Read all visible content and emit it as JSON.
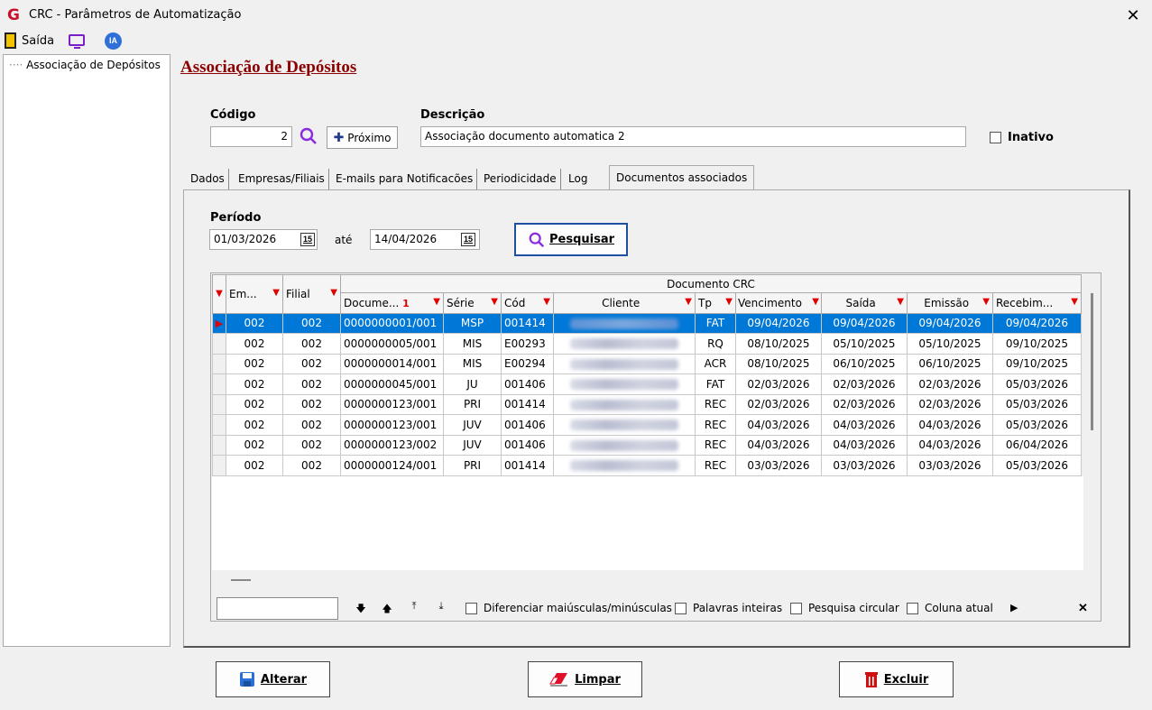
{
  "window": {
    "title": "CRC - Parâmetros de Automatização",
    "app_glyph": "G"
  },
  "menu": {
    "saida": "Saída",
    "ia": "IA"
  },
  "tree": {
    "item": "Associação de Depósitos"
  },
  "page": {
    "title": "Associação de Depósitos"
  },
  "form": {
    "codigo_label": "Código",
    "codigo_value": "2",
    "proximo_label": "Próximo",
    "descricao_label": "Descrição",
    "descricao_value": "Associação documento automatica 2",
    "inativo_label": "Inativo"
  },
  "tabs": [
    "Dados",
    "Empresas/Filiais",
    "E-mails para Notificacões",
    "Periodicidade",
    "Log",
    "Documentos associados"
  ],
  "periodo": {
    "label": "Período",
    "from": "01/03/2026",
    "ate": "até",
    "to": "14/04/2026",
    "calendar_glyph": "15",
    "search_label": "Pesquisar"
  },
  "grid": {
    "group_header": "Documento CRC",
    "headers": [
      "Em...",
      "Filial",
      "Docume...",
      "Série",
      "Cód",
      "Cliente",
      "Tp",
      "Vencimento",
      "Saída",
      "Emissão",
      "Recebim..."
    ],
    "sort_badge": "1",
    "rows": [
      [
        "002",
        "002",
        "0000000001/001",
        "MSP",
        "001414",
        "",
        "FAT",
        "09/04/2026",
        "09/04/2026",
        "09/04/2026",
        "09/04/2026"
      ],
      [
        "002",
        "002",
        "0000000005/001",
        "MIS",
        "E00293",
        "",
        "RQ",
        "08/10/2025",
        "05/10/2025",
        "05/10/2025",
        "09/10/2025"
      ],
      [
        "002",
        "002",
        "0000000014/001",
        "MIS",
        "E00294",
        "",
        "ACR",
        "08/10/2025",
        "06/10/2025",
        "06/10/2025",
        "09/10/2025"
      ],
      [
        "002",
        "002",
        "0000000045/001",
        "JU",
        "001406",
        "",
        "FAT",
        "02/03/2026",
        "02/03/2026",
        "02/03/2026",
        "05/03/2026"
      ],
      [
        "002",
        "002",
        "0000000123/001",
        "PRI",
        "001414",
        "",
        "REC",
        "02/03/2026",
        "02/03/2026",
        "02/03/2026",
        "05/03/2026"
      ],
      [
        "002",
        "002",
        "0000000123/001",
        "JUV",
        "001406",
        "",
        "REC",
        "04/03/2026",
        "04/03/2026",
        "04/03/2026",
        "05/03/2026"
      ],
      [
        "002",
        "002",
        "0000000123/002",
        "JUV",
        "001406",
        "",
        "REC",
        "04/03/2026",
        "04/03/2026",
        "04/03/2026",
        "06/04/2026"
      ],
      [
        "002",
        "002",
        "0000000124/001",
        "PRI",
        "001414",
        "",
        "REC",
        "03/03/2026",
        "03/03/2026",
        "03/03/2026",
        "05/03/2026"
      ]
    ]
  },
  "searchbar": {
    "case_label": "Diferenciar maiúsculas/minúsculas",
    "words_label": "Palavras inteiras",
    "circular_label": "Pesquisa circular",
    "column_label": "Coluna atual"
  },
  "actions": {
    "alterar": "Alterar",
    "limpar": "Limpar",
    "excluir": "Excluir"
  }
}
